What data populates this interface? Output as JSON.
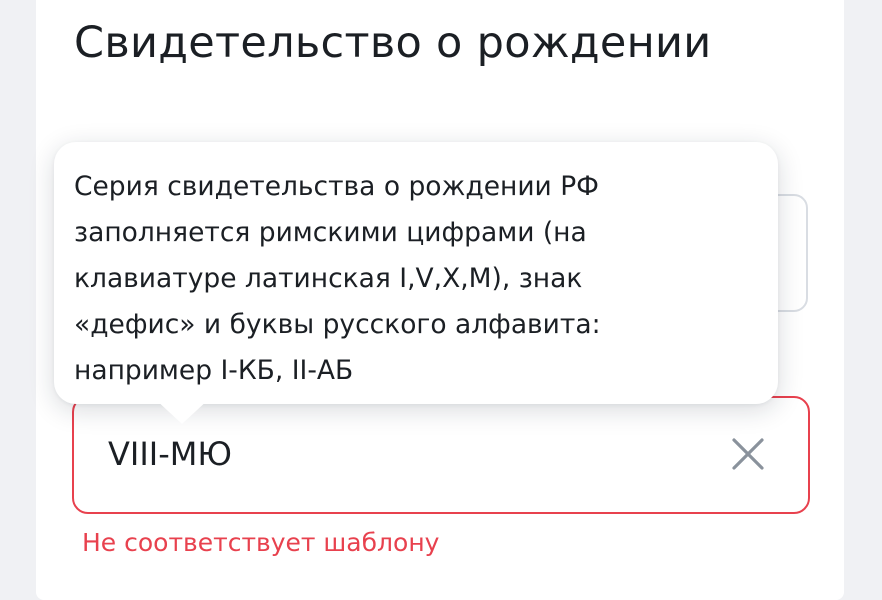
{
  "form": {
    "title": "Свидетельство о рождении",
    "series_input": {
      "value": "VIII-МЮ",
      "error": "Не соответствует шаблону",
      "error_color": "#e8414e"
    }
  },
  "tooltip": {
    "lines": [
      "Серия свидетельства о рождении РФ",
      "заполняется римскими цифрами (на",
      "клавиатуре латинская I,V,X,M), знак",
      "«дефис» и буквы русского алфавита:",
      "например I-КБ, II-АБ"
    ]
  },
  "icons": {
    "clear": "close-icon"
  }
}
